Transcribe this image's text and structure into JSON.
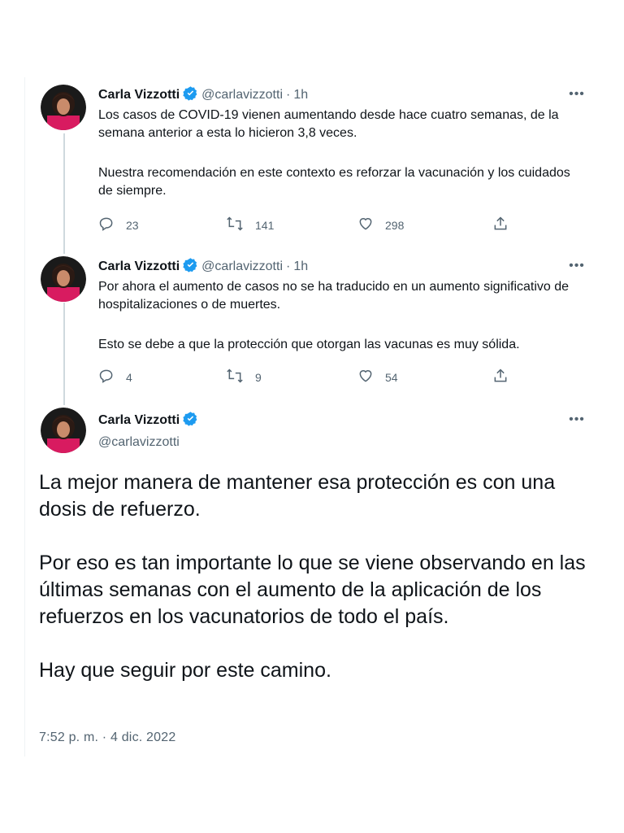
{
  "tweets": [
    {
      "name": "Carla Vizzotti",
      "handle": "@carlavizzotti",
      "time": "1h",
      "text_p1": "Los casos de COVID-19 vienen aumentando desde hace cuatro semanas, de la semana anterior a esta lo hicieron 3,8 veces.",
      "text_p2": "Nuestra recomendación en este contexto es reforzar la vacunación y los cuidados de siempre.",
      "replies": "23",
      "retweets": "141",
      "likes": "298"
    },
    {
      "name": "Carla Vizzotti",
      "handle": "@carlavizzotti",
      "time": "1h",
      "text_p1": "Por ahora el aumento de casos no se ha traducido en un aumento significativo de hospitalizaciones o de muertes.",
      "text_p2": "Esto se debe a que la protección que otorgan las vacunas es muy sólida.",
      "replies": "4",
      "retweets": "9",
      "likes": "54"
    }
  ],
  "main_tweet": {
    "name": "Carla Vizzotti",
    "handle": "@carlavizzotti",
    "paragraphs": [
      "La mejor manera de mantener esa protección es con una dosis de refuerzo.",
      "Por eso es tan importante lo que se viene observando en las últimas semanas con el aumento de la aplicación de los refuerzos en los vacunatorios de todo el país.",
      "Hay que seguir por este camino."
    ],
    "timestamp": "7:52 p. m. · 4 dic. 2022"
  },
  "separator": "·",
  "icons": {
    "verified": "verified-badge-icon",
    "reply": "reply-icon",
    "retweet": "retweet-icon",
    "like": "heart-icon",
    "share": "share-icon",
    "more": "more-options-icon"
  },
  "colors": {
    "verified": "#1d9bf0",
    "secondary_text": "#536471",
    "thread_line": "#cfd9de"
  }
}
